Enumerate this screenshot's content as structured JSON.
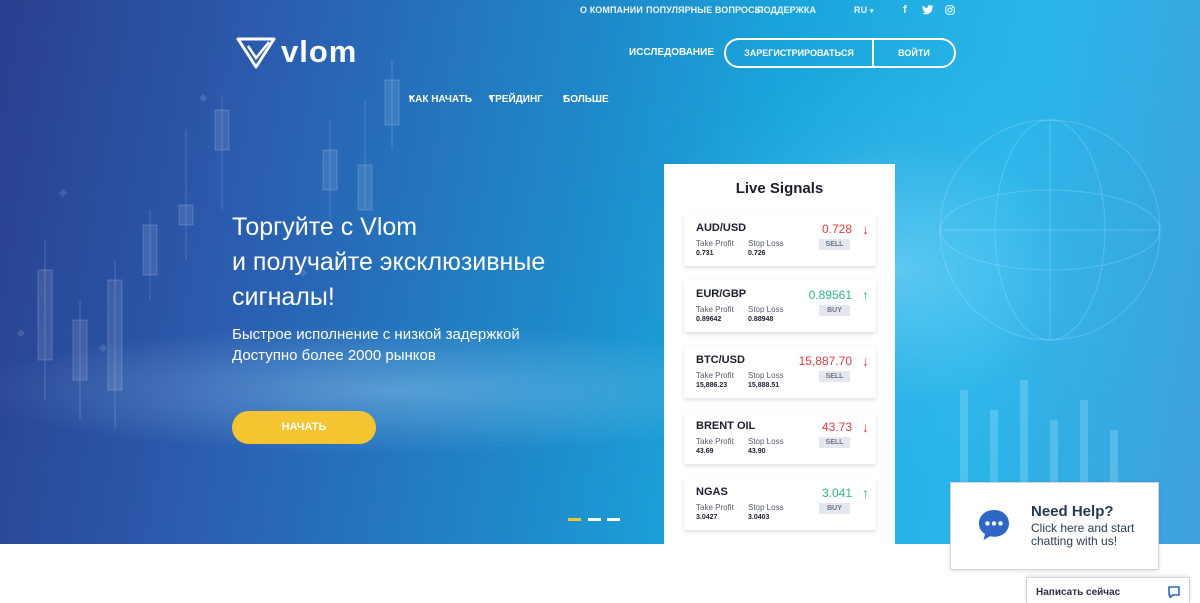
{
  "top_links": [
    "О КОМПАНИИ",
    "ПОПУЛЯРНЫЕ ВОПРОСЫ",
    "ПОДДЕРЖКА"
  ],
  "language": "RU",
  "social": [
    "f",
    "t",
    "ig"
  ],
  "logo_text": "vlom",
  "nav": [
    "КАК НАЧАТЬ",
    "ТРЕЙДИНГ",
    "БОЛЬШЕ",
    "ИССЛЕДОВАНИЕ"
  ],
  "auth": {
    "register": "ЗАРЕГИСТРИРОВАТЬСЯ",
    "login": "ВОЙТИ"
  },
  "hero": {
    "headline_1": "Торгуйте с Vlom",
    "headline_2": "и получайте эксклюзивные",
    "headline_3": "сигналы!",
    "sub_1": "Быстрое исполнение с низкой задержкой",
    "sub_2": "Доступно более 2000 рынков",
    "cta": "НАЧАТЬ"
  },
  "signals": {
    "title": "Live Signals",
    "take_profit_label": "Take Profit",
    "stop_loss_label": "Stop Loss",
    "items": [
      {
        "pair": "AUD/USD",
        "take_profit": "0.731",
        "stop_loss": "0.726",
        "price": "0.728",
        "action": "SELL",
        "direction": "down"
      },
      {
        "pair": "EUR/GBP",
        "take_profit": "0.89642",
        "stop_loss": "0.88948",
        "price": "0.89561",
        "action": "BUY",
        "direction": "up"
      },
      {
        "pair": "BTC/USD",
        "take_profit": "15,886.23",
        "stop_loss": "15,888.51",
        "price": "15,887.70",
        "action": "SELL",
        "direction": "down"
      },
      {
        "pair": "BRENT OIL",
        "take_profit": "43.69",
        "stop_loss": "43.90",
        "price": "43.73",
        "action": "SELL",
        "direction": "down"
      },
      {
        "pair": "NGAS",
        "take_profit": "3.0427",
        "stop_loss": "3.0403",
        "price": "3.041",
        "action": "BUY",
        "direction": "up"
      }
    ]
  },
  "help": {
    "title": "Need Help?",
    "text": "Click here and start chatting with us!"
  },
  "chat": {
    "label": "Написать сейчас"
  },
  "colors": {
    "accent": "#f5c431",
    "sell": "#e63b3b",
    "buy": "#2eb88a"
  }
}
